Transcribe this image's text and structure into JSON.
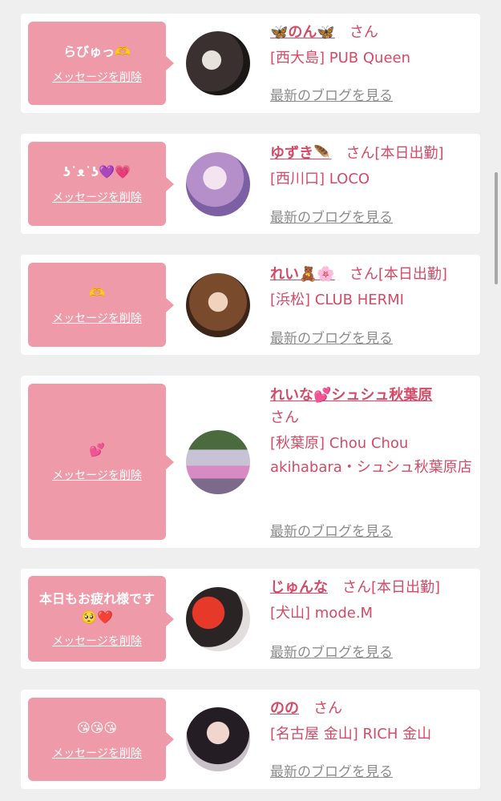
{
  "delete_label": "メッセージを削除",
  "blog_label": "最新のブログを見る",
  "san_label": "さん",
  "cards": [
    {
      "message": "らびゅっ🫶",
      "name": "🦋のん🦋",
      "status": "",
      "shop": "[西大島] PUB Queen",
      "avatar_icon": "photo-avatar"
    },
    {
      "message": "ʖ˙ᴥ˙ʖ💜💗",
      "name": "ゆずき🪶",
      "status": "[本日出勤]",
      "shop": "[西川口] LOCO",
      "avatar_icon": "photo-avatar"
    },
    {
      "message": "🫶",
      "name": "れい🧸🌸",
      "status": "[本日出勤]",
      "shop": "[浜松] CLUB HERMI",
      "avatar_icon": "photo-avatar"
    },
    {
      "message": "💕",
      "name": "れいな💕シュシュ秋葉原",
      "status": "",
      "shop": "[秋葉原] Chou Chou akihabara・シュシュ秋葉原店",
      "avatar_icon": "photo-avatar"
    },
    {
      "message": "本日もお疲れ様です🥺❤️",
      "name": "じゅんな",
      "status": "[本日出勤]",
      "shop": "[犬山] mode.M",
      "avatar_icon": "photo-avatar"
    },
    {
      "message": "😘😘😘",
      "name": "のの",
      "status": "",
      "shop": "[名古屋 金山] RICH 金山",
      "avatar_icon": "photo-avatar"
    }
  ]
}
